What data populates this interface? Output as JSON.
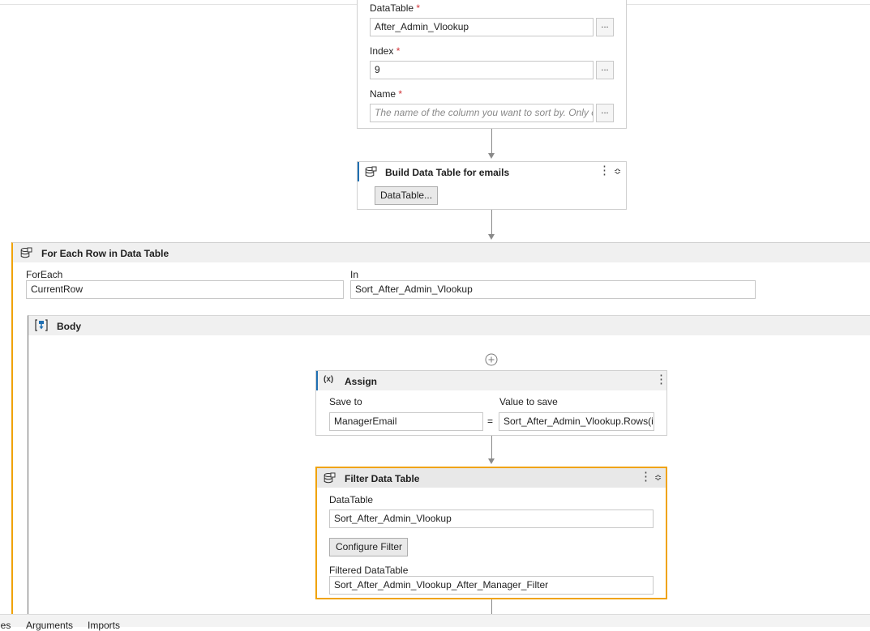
{
  "sort_activity": {
    "datatable_label": "DataTable",
    "datatable_value": "After_Admin_Vlookup",
    "index_label": "Index",
    "index_value": "9",
    "name_label": "Name",
    "name_placeholder": "The name of the column you want to sort by. Only o",
    "required_mark": "*",
    "more_button": "..."
  },
  "build_activity": {
    "title": "Build Data Table for emails",
    "button_label": "DataTable..."
  },
  "foreach_activity": {
    "title": "For Each Row in Data Table",
    "foreach_label": "ForEach",
    "foreach_value": "CurrentRow",
    "in_label": "In",
    "in_value": "Sort_After_Admin_Vlookup",
    "body_title": "Body"
  },
  "assign_activity": {
    "icon_text": "(x)",
    "title": "Assign",
    "save_to_label": "Save to",
    "save_to_value": "ManagerEmail",
    "equals": "=",
    "value_label": "Value to save",
    "value_value": "Sort_After_Admin_Vlookup.Rows(i"
  },
  "filter_activity": {
    "title": "Filter Data Table",
    "datatable_label": "DataTable",
    "datatable_value": "Sort_After_Admin_Vlookup",
    "configure_button": "Configure Filter",
    "filtered_label": "Filtered DataTable",
    "filtered_value": "Sort_After_Admin_Vlookup_After_Manager_Filter"
  },
  "bottom_tabs": [
    "les",
    "Arguments",
    "Imports"
  ],
  "colors": {
    "selection": "#f0a30a",
    "header_bg": "#f0f0f0",
    "required": "#d13438"
  }
}
